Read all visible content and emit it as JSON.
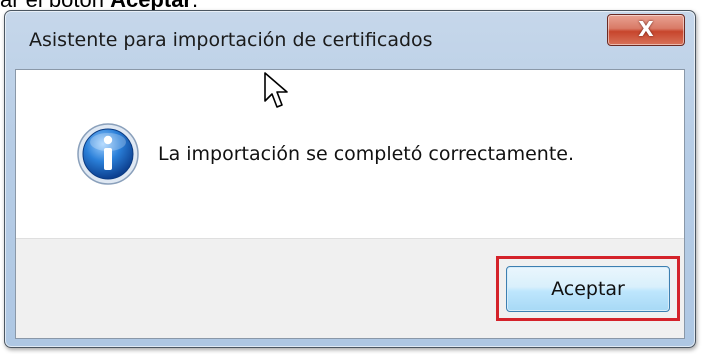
{
  "caption": {
    "prefix": "ar el botón ",
    "bold": "Aceptar",
    "suffix": "."
  },
  "dialog": {
    "title": "Asistente para importación de certificados",
    "close_label": "X",
    "message": "La importación se completó correctamente.",
    "icon": "info-icon",
    "accept_label": "Aceptar"
  },
  "colors": {
    "highlight": "#d4222a",
    "close_button": "#c7452c",
    "accept_button": "#bee6fd"
  }
}
